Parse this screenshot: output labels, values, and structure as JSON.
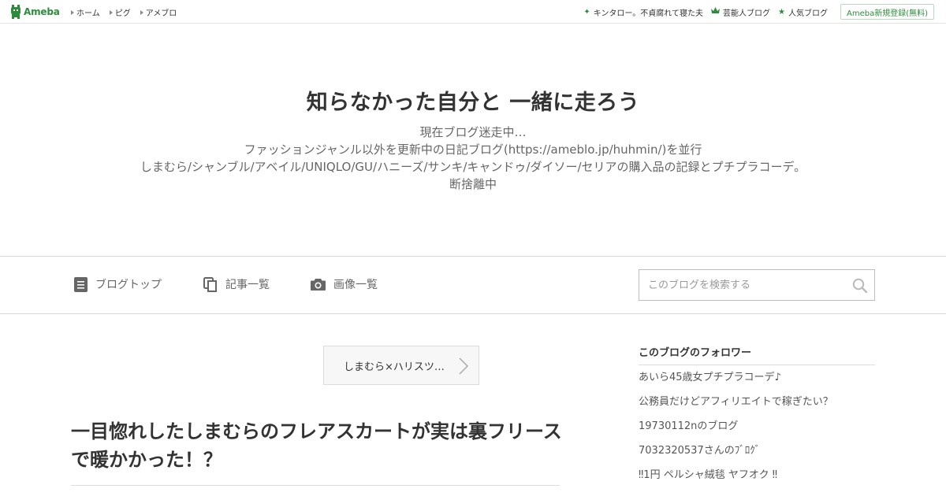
{
  "topbar": {
    "logo_text": "Ameba",
    "nav": [
      {
        "label": "ホーム"
      },
      {
        "label": "ピグ"
      },
      {
        "label": "アメブロ"
      }
    ],
    "right_links": [
      {
        "label": "キンタロー。不貞腐れて寝た夫",
        "icon": "sparkle-icon"
      },
      {
        "label": "芸能人ブログ",
        "icon": "crown-icon"
      },
      {
        "label": "人気ブログ",
        "icon": "star-icon"
      }
    ],
    "signup_label": "Ameba新規登録(無料)"
  },
  "header": {
    "title": "知らなかった自分と 一緒に走ろう",
    "description": [
      "現在ブログ迷走中…",
      "ファッションジャンル以外を更新中の日記ブログ(https://ameblo.jp/huhmin/)を並行",
      "しまむら/シャンブル/アベイル/UNIQLO/GU/ハニーズ/サンキ/キャンドゥ/ダイソー/セリアの購入品の記録とプチプラコーデ。",
      "断捨離中"
    ]
  },
  "nav": {
    "items": [
      {
        "label": "ブログトップ",
        "icon": "document-icon"
      },
      {
        "label": "記事一覧",
        "icon": "copy-icon"
      },
      {
        "label": "画像一覧",
        "icon": "camera-icon"
      }
    ],
    "search_placeholder": "このブログを検索する"
  },
  "main": {
    "theme_label": "しまむら×ハリスツ…",
    "article_title": "一目惚れしたしまむらのフレアスカートが実は裏フリースで暖かかった！？"
  },
  "sidebar": {
    "followers_heading": "このブログのフォロワー",
    "followers": [
      "あいら45歳女プチプラコーデ♪",
      "公務員だけどアフィリエイトで稼ぎたい？",
      "19730112nのブログ",
      "7032320537さんのﾌﾞﾛｸﾞ",
      "‼1円 ペルシャ絨毯 ヤフオク ‼"
    ]
  },
  "colors": {
    "brand_green": "#2d8c3c",
    "text": "#333333",
    "muted": "#666666",
    "border": "#d9d9d9"
  }
}
